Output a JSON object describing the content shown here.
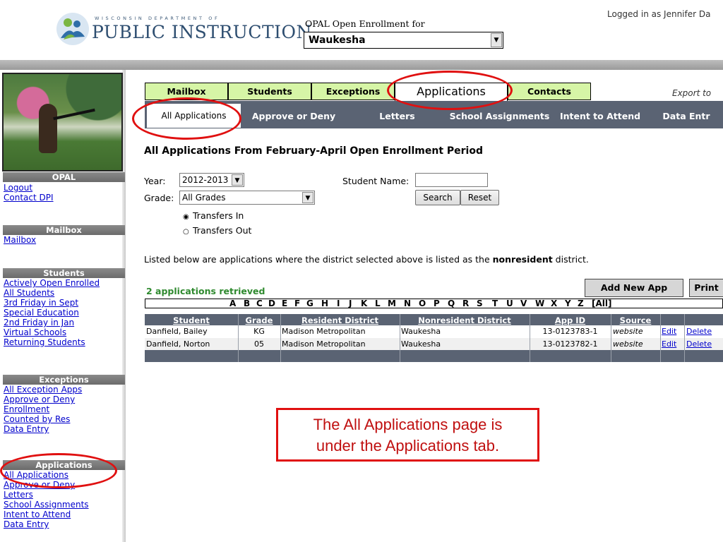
{
  "header": {
    "logo_line1": "WISCONSIN DEPARTMENT OF",
    "logo_line2": "PUBLIC INSTRUCTION",
    "opal_for": "OPAL Open Enrollment for",
    "district": "Waukesha",
    "logged_in": "Logged in as Jennifer Da"
  },
  "sidebar": {
    "opal_head": "OPAL",
    "opal_links": [
      "Logout",
      "Contact DPI"
    ],
    "mailbox_head": "Mailbox",
    "mailbox_links": [
      "Mailbox"
    ],
    "students_head": "Students",
    "students_links": [
      "Actively Open Enrolled",
      "All Students",
      "3rd Friday in Sept",
      "Special Education",
      "2nd Friday in Jan",
      "Virtual Schools",
      "Returning Students"
    ],
    "exceptions_head": "Exceptions",
    "exceptions_links": [
      "All Exception Apps",
      "Approve or Deny",
      "Enrollment",
      "Counted by Res",
      "Data Entry"
    ],
    "applications_head": "Applications",
    "applications_links": [
      "All Applications",
      "Approve or Deny",
      "Letters",
      "School Assignments",
      "Intent to Attend",
      "Data Entry"
    ]
  },
  "tabs": [
    "Mailbox",
    "Students",
    "Exceptions",
    "Applications",
    "Contacts"
  ],
  "export_label": "Export to",
  "subtabs": [
    "All Applications",
    "Approve or Deny",
    "Letters",
    "School Assignments",
    "Intent to Attend",
    "Data Entr"
  ],
  "main": {
    "title": "All Applications From February-April Open Enrollment Period",
    "year_label": "Year:",
    "year_value": "2012-2013",
    "grade_label": "Grade:",
    "grade_value": "All Grades",
    "student_name_label": "Student Name:",
    "student_name_value": "",
    "search_button": "Search",
    "reset_button": "Reset",
    "radio_in": "Transfers In",
    "radio_out": "Transfers Out",
    "note_pre": "Listed below are applications where the district selected above is listed as the ",
    "note_bold": "nonresident",
    "note_post": " district.",
    "retrieved": "2 applications retrieved",
    "add_new_button": "Add New App",
    "print_button": "Print"
  },
  "alphabet": [
    "A",
    "B",
    "C",
    "D",
    "E",
    "F",
    "G",
    "H",
    "I",
    "J",
    "K",
    "L",
    "M",
    "N",
    "O",
    "P",
    "Q",
    "R",
    "S",
    "T",
    "U",
    "V",
    "W",
    "X",
    "Y",
    "Z",
    "[All]"
  ],
  "table": {
    "columns": [
      "Student",
      "Grade",
      "Resident District",
      "Nonresident District",
      "App ID",
      "Source"
    ],
    "rows": [
      {
        "student": "Danfield, Bailey",
        "grade": "KG",
        "resident": "Madison Metropolitan",
        "nonresident": "Waukesha",
        "app_id": "13-0123783-1",
        "source": "website",
        "edit": "Edit",
        "delete": "Delete"
      },
      {
        "student": "Danfield, Norton",
        "grade": "05",
        "resident": "Madison Metropolitan",
        "nonresident": "Waukesha",
        "app_id": "13-0123782-1",
        "source": "website",
        "edit": "Edit",
        "delete": "Delete"
      }
    ]
  },
  "callout": {
    "line1": "The All Applications page is",
    "line2": "under the Applications tab."
  },
  "colors": {
    "tab_green": "#d6f5a6",
    "subbar": "#5a6373",
    "annotation_red": "#e01010",
    "retrieved_green": "#2f8a2f"
  }
}
